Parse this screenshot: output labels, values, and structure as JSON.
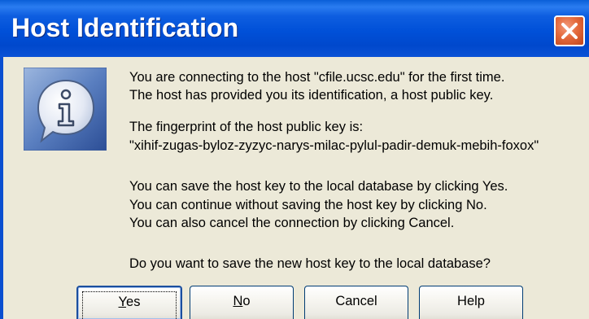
{
  "window": {
    "title": "Host Identification",
    "close_icon": "close-icon"
  },
  "dialog": {
    "icon": "info-icon",
    "messages": {
      "line1": "You are connecting to the host \"cfile.ucsc.edu\" for the first time.",
      "line2": "The host has provided you its identification, a host public key.",
      "line3": "The fingerprint of the host public key is:",
      "line4": "\"xihif-zugas-byloz-zyzyc-narys-milac-pylul-padir-demuk-mebih-foxox\"",
      "line5": "You can save the host key to the local database by clicking Yes.",
      "line6": "You can continue without saving the host key by clicking No.",
      "line7": "You can also cancel the connection by clicking Cancel.",
      "line8": "Do you want to save the new host key to the local database?"
    }
  },
  "buttons": {
    "yes": {
      "accel": "Y",
      "rest": "es"
    },
    "no": {
      "accel": "N",
      "rest": "o"
    },
    "cancel": {
      "label": "Cancel"
    },
    "help": {
      "label": "Help"
    }
  },
  "colors": {
    "titlebar": "#0050d8",
    "close_button": "#e46a3c",
    "dialog_background": "#ece9d8"
  }
}
